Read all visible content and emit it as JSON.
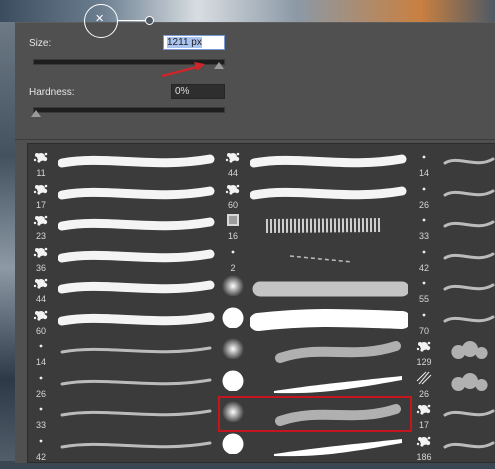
{
  "brush_picker": {
    "size_label": "Size:",
    "size_value": "1211 px",
    "size_slider_fraction": 0.98,
    "hardness_label": "Hardness:",
    "hardness_value": "0%",
    "hardness_slider_fraction": 0.0
  },
  "columns": [
    {
      "presets": [
        {
          "size": "11",
          "tip": "splatter",
          "stroke": "rough"
        },
        {
          "size": "17",
          "tip": "splatter",
          "stroke": "rough"
        },
        {
          "size": "23",
          "tip": "splatter",
          "stroke": "rough"
        },
        {
          "size": "36",
          "tip": "splatter",
          "stroke": "rough"
        },
        {
          "size": "44",
          "tip": "splatter",
          "stroke": "rough"
        },
        {
          "size": "60",
          "tip": "splatter",
          "stroke": "rough"
        },
        {
          "size": "14",
          "tip": "dot",
          "stroke": "soft-thin"
        },
        {
          "size": "26",
          "tip": "dot",
          "stroke": "soft-thin"
        },
        {
          "size": "33",
          "tip": "dot",
          "stroke": "soft-thin"
        },
        {
          "size": "42",
          "tip": "dot",
          "stroke": "soft-thin"
        }
      ]
    },
    {
      "presets": [
        {
          "size": "44",
          "tip": "splatter",
          "stroke": "rough"
        },
        {
          "size": "60",
          "tip": "splatter",
          "stroke": "rough"
        },
        {
          "size": "16",
          "tip": "texture",
          "stroke": "texture"
        },
        {
          "size": "2",
          "tip": "dot",
          "stroke": "hairline"
        },
        {
          "size": "",
          "tip": "soft-round",
          "stroke": "soft-wide"
        },
        {
          "size": "",
          "tip": "hard-round",
          "stroke": "hard-wide"
        },
        {
          "size": "",
          "tip": "soft-round",
          "stroke": "soft-taper"
        },
        {
          "size": "",
          "tip": "hard-round",
          "stroke": "hard-taper"
        },
        {
          "size": "",
          "tip": "soft-round",
          "stroke": "soft-selected",
          "selected": true
        },
        {
          "size": "",
          "tip": "hard-round",
          "stroke": "hard-taper"
        }
      ]
    },
    {
      "presets": [
        {
          "size": "14",
          "tip": "dot",
          "stroke": "soft-thin"
        },
        {
          "size": "26",
          "tip": "dot",
          "stroke": "soft-thin"
        },
        {
          "size": "33",
          "tip": "dot",
          "stroke": "soft-thin"
        },
        {
          "size": "42",
          "tip": "dot",
          "stroke": "soft-thin"
        },
        {
          "size": "55",
          "tip": "dot",
          "stroke": "soft-thin"
        },
        {
          "size": "70",
          "tip": "dot",
          "stroke": "soft-thin"
        },
        {
          "size": "129",
          "tip": "splatter",
          "stroke": "cloud"
        },
        {
          "size": "26",
          "tip": "grass",
          "stroke": "cloud"
        },
        {
          "size": "17",
          "tip": "splatter",
          "stroke": "soft-thin"
        },
        {
          "size": "186",
          "tip": "splatter",
          "stroke": "soft-thin"
        }
      ]
    }
  ],
  "colors": {
    "panel": "#505050",
    "list_bg": "#3b3b3b",
    "highlight": "#c4161c",
    "annotation_arrow": "#d0252a"
  },
  "icons": [
    "close-icon",
    "brush-preview-ring",
    "red-arrow-annotation"
  ]
}
